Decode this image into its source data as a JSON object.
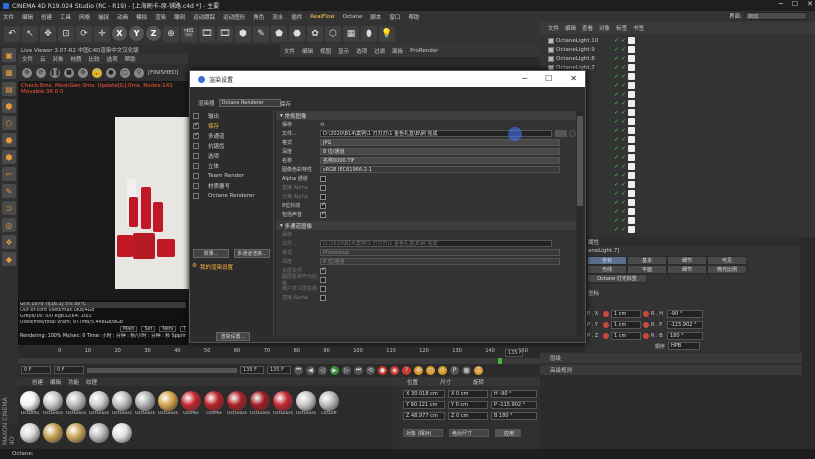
{
  "title": "CINEMA 4D R19.024 Studio (RC - R19) - [上海刷卡-原-铺路.c4d *] - 主要",
  "menu": [
    "文件",
    "编辑",
    "创建",
    "工具",
    "网格",
    "捕捉",
    "动画",
    "模拟",
    "渲染",
    "雕刻",
    "运动跟踪",
    "运动图形",
    "角色",
    "流水",
    "插件",
    "RealFlow",
    "Octane",
    "脚本",
    "窗口",
    "帮助"
  ],
  "layout": {
    "label": "界面:",
    "value": "启动"
  },
  "toolbar": [
    "↶",
    "↖",
    "✥",
    "⊡",
    "⟳",
    "✛",
    "X",
    "Y",
    "Z",
    "⊕",
    "🎬",
    "🎞",
    "🎞",
    "⬢",
    "✎",
    "⬟",
    "⬣",
    "✿",
    "⬡",
    "▦",
    "⬮",
    "💡"
  ],
  "viewport": {
    "title": "Live Viewer 3.07-R2 中国C4D渲染中文汉化版",
    "menu": [
      "文件",
      "云",
      "对象",
      "材质",
      "比较",
      "选项",
      "帮助"
    ],
    "finished": "[FINISHED]",
    "info": "Check:8ms. MeshGen:0ms. Update[G]:0ms. Nodes:141 Movable:36 0 0"
  },
  "stats": [
    "GTX 1070 Ti[16.1]  5%  50°C",
    "Out-of-core used/max:0Kb/4Gb",
    "Grey8/16: 0/0     Rgb32/64: 20/2",
    "Used/free/total vram: 977MB/5.448Gb/8Gb",
    "Rendering: 100%  Ms/sec: 0  Time: 小时 : 分钟 : 秒/小时 : 分钟 : 秒 Spp/maxspp: 80/80  Tri: 0/2045k Mesh: 209 Hair: 0"
  ],
  "statsTabs": [
    "Main",
    "Set",
    "Nets",
    "Time"
  ],
  "topmid": [
    "文件",
    "编辑",
    "查看",
    "对象",
    "标签",
    "书签"
  ],
  "midtabs": [
    "模式",
    "编辑",
    "用户数据"
  ],
  "midmenu": [
    "文件",
    "编辑",
    "视图",
    "显示",
    "选项",
    "过滤",
    "面板",
    "ProRender"
  ],
  "objects": {
    "header": [
      "文件",
      "编辑",
      "查看",
      "对象",
      "标签",
      "书签"
    ],
    "rows": [
      "OctaneLight.10",
      "OctaneLight.9",
      "OctaneLight.8",
      "OctaneLight.7",
      "",
      "",
      "",
      "",
      "",
      "",
      "",
      "",
      "",
      "",
      "",
      "mera",
      "",
      "",
      "",
      "",
      "",
      ""
    ]
  },
  "attr": {
    "header": "属性",
    "obj": "aneLight.7]",
    "tabs1": [
      "坐标",
      "基本",
      "细节",
      "可见"
    ],
    "tabs2": [
      "光线",
      "平面",
      "细节",
      "微光比例"
    ],
    "tabs3": [
      "Octane 灯光标签"
    ],
    "coordsTitle": "坐标",
    "coords": [
      {
        "a": "P . X",
        "av": "1 cm",
        "b": "R . H",
        "bv": "-90 °"
      },
      {
        "a": "P . Y",
        "av": "1 cm",
        "b": "R . P",
        "bv": "-115.902 °"
      },
      {
        "a": "P . Z",
        "av": "1 cm",
        "b": "R . B",
        "bv": "180 °"
      }
    ],
    "order": "顺序",
    "orderVal": "HPB"
  },
  "extra": [
    "层级",
    "高级规则"
  ],
  "timeline": {
    "ticks": [
      "0",
      "10",
      "20",
      "30",
      "40",
      "50",
      "60",
      "70",
      "80",
      "90",
      "100",
      "110",
      "120",
      "130",
      "140",
      "150"
    ],
    "frame": "0 F",
    "start": "0 F",
    "end": "135 F",
    "endB": "135 F",
    "cur": "135 F"
  },
  "materials": {
    "tabs": [
      "创建",
      "编辑",
      "功能",
      "纹理"
    ],
    "items": [
      {
        "label": "OctDiffu",
        "color": "#f3f3f3"
      },
      {
        "label": "OctGloss",
        "color": "#c8c8c8"
      },
      {
        "label": "OctGloss",
        "color": "#bdbdbd"
      },
      {
        "label": "OctGloss",
        "color": "#cfcfcf"
      },
      {
        "label": "OctGloss",
        "color": "#c0c0c0"
      },
      {
        "label": "OctGloss",
        "color": "#b1b1b1"
      },
      {
        "label": "OctGloss",
        "color": "#d6a64a"
      },
      {
        "label": "OctMix",
        "color": "#c5262d"
      },
      {
        "label": "OctMix",
        "color": "#b8222a"
      },
      {
        "label": "OctGloss",
        "color": "#a81e25"
      },
      {
        "label": "OctGloss",
        "color": "#9e1b22"
      },
      {
        "label": "OctGloss",
        "color": "#c22630"
      },
      {
        "label": "OctGloss",
        "color": "#c8c8c8"
      },
      {
        "label": "OctDiff",
        "color": "#bbbbbb"
      },
      {
        "label": "",
        "color": "#d8d8d8"
      },
      {
        "label": "",
        "color": "#c8a052"
      },
      {
        "label": "",
        "color": "#caa65a"
      },
      {
        "label": "",
        "color": "#bdbdbd"
      },
      {
        "label": "",
        "color": "#e2e2e2"
      }
    ]
  },
  "coordPanel": {
    "headers": [
      "位置",
      "尺寸",
      "旋转"
    ],
    "rows": [
      {
        "p": "X  30.018 cm",
        "s": "X  0 cm",
        "r": "H  -90 °"
      },
      {
        "p": "Y  90.121 cm",
        "s": "Y  0 cm",
        "r": "P  -115.902 °"
      },
      {
        "p": "Z  48.977 cm",
        "s": "Z  0 cm",
        "r": "B  180 °"
      }
    ],
    "mode1": "对象 (相对)",
    "mode2": "绝对尺寸",
    "apply": "应用"
  },
  "status": "Octane:",
  "maxon": "MAXON CINEMA 4D",
  "dialog": {
    "title": "渲染设置",
    "rendererLabel": "渲染器",
    "renderer": "Octane Renderer",
    "save": "保存",
    "left": [
      {
        "t": "输出",
        "on": false
      },
      {
        "t": "保存",
        "on": true,
        "sel": true
      },
      {
        "t": "多通道",
        "on": true
      },
      {
        "t": "抗锯齿",
        "on": false
      },
      {
        "t": "选项",
        "on": false
      },
      {
        "t": "立体",
        "on": false
      },
      {
        "t": "Team Render",
        "on": false
      },
      {
        "t": "材质覆写",
        "on": false
      },
      {
        "t": "Octane Renderer",
        "on": false
      }
    ],
    "effectBtn": "效果...",
    "multiBtn": "多通道渲染...",
    "myRender": "我的渲染设置",
    "renderSettingsBtn": "渲染设置...",
    "regular": "常规图像",
    "saveRow": "保存",
    "fileLabel": "文件...",
    "filePath": "D:\\2020\\B14\\案例\\1 刃刃刃\\1 金色礼盒\\B\\刷 完成",
    "formatLabel": "格式",
    "format": "JPG",
    "depthLabel": "深度",
    "depth": "8 位/通道",
    "nameLabel": "名称",
    "name": "名称0000.TIF",
    "profileLabel": "图像色彩特性",
    "profile": "sRGB IEC61966-2.1",
    "alphaLabel": "Alpha 通道",
    "straightLabel": "直接 Alpha",
    "sepLabel": "分离 Alpha",
    "bitLabel": "8位抖动",
    "soundLabel": "包括声音",
    "multiHdr": "多通道图像",
    "mSave": "保存",
    "mFile": "文件...",
    "mPath": "D:\\2020\\B14\\案例\\1 刃刃刃\\1 金色礼盒\\B\\刷 完成",
    "mFormat": "格式",
    "mFormatVal": "Photoshop",
    "mDepth": "深度",
    "mDepthVal": "8 位/通道",
    "mLayer": "多层文件",
    "mName": "图层名称作为后缀",
    "mUser": "用户定义层名称",
    "mStraight": "直接 Alpha"
  }
}
